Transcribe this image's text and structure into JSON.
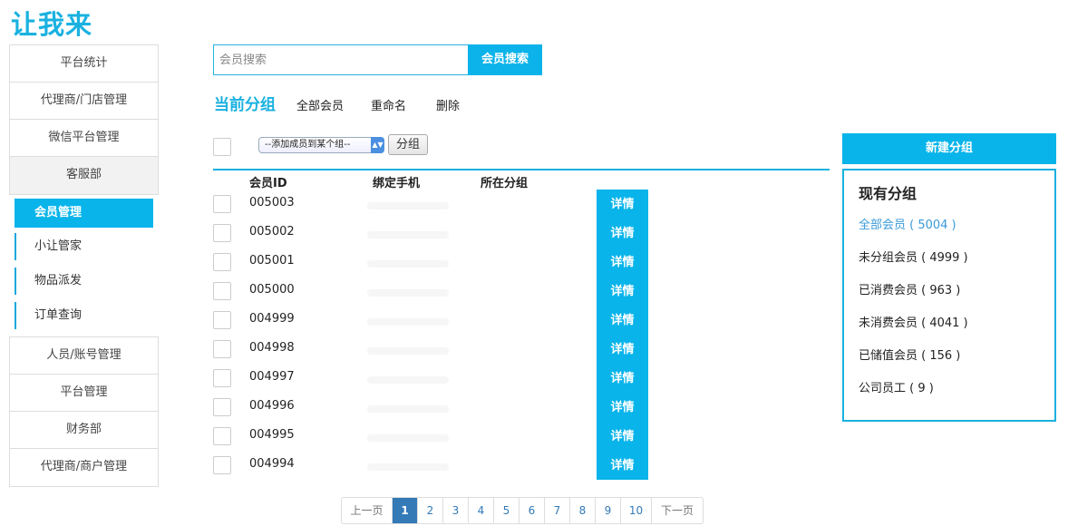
{
  "app": {
    "logo": "让我来"
  },
  "sidebar": {
    "top_items": [
      {
        "label": "平台统计"
      },
      {
        "label": "代理商/门店管理"
      },
      {
        "label": "微信平台管理"
      },
      {
        "label": "客服部"
      }
    ],
    "sub_items": [
      {
        "label": "会员管理",
        "active": true
      },
      {
        "label": "小让管家"
      },
      {
        "label": "物品派发"
      },
      {
        "label": "订单查询"
      }
    ],
    "bottom_items": [
      {
        "label": "人员/账号管理"
      },
      {
        "label": "平台管理"
      },
      {
        "label": "财务部"
      },
      {
        "label": "代理商/商户管理"
      }
    ]
  },
  "search": {
    "placeholder": "会员搜索",
    "button_label": "会员搜索"
  },
  "group_bar": {
    "title": "当前分组",
    "links": [
      "全部会员",
      "重命名",
      "删除"
    ]
  },
  "toolbar": {
    "select_value": "--添加成员到某个组--",
    "group_button": "分组"
  },
  "table": {
    "headers": [
      "会员ID",
      "绑定手机",
      "所在分组"
    ],
    "detail_label": "详情",
    "rows": [
      {
        "id": "005003"
      },
      {
        "id": "005002"
      },
      {
        "id": "005001"
      },
      {
        "id": "005000"
      },
      {
        "id": "004999"
      },
      {
        "id": "004998"
      },
      {
        "id": "004997"
      },
      {
        "id": "004996"
      },
      {
        "id": "004995"
      },
      {
        "id": "004994"
      }
    ]
  },
  "pagination": {
    "prev": "上一页",
    "pages": [
      "1",
      "2",
      "3",
      "4",
      "5",
      "6",
      "7",
      "8",
      "9",
      "10"
    ],
    "current": "1",
    "next": "下一页"
  },
  "groups": {
    "new_button": "新建分组",
    "title": "现有分组",
    "items": [
      {
        "label": "全部会员 ( 5004 )"
      },
      {
        "label": "未分组会员 ( 4999 )"
      },
      {
        "label": "已消费会员 ( 963 )"
      },
      {
        "label": "未消费会员 ( 4041 )"
      },
      {
        "label": "已储值会员 ( 156 )"
      },
      {
        "label": "公司员工 ( 9 )"
      }
    ]
  },
  "colors": {
    "accent": "#08b4ea",
    "pager_active": "#337ab7",
    "link": "#3a9ad9"
  }
}
